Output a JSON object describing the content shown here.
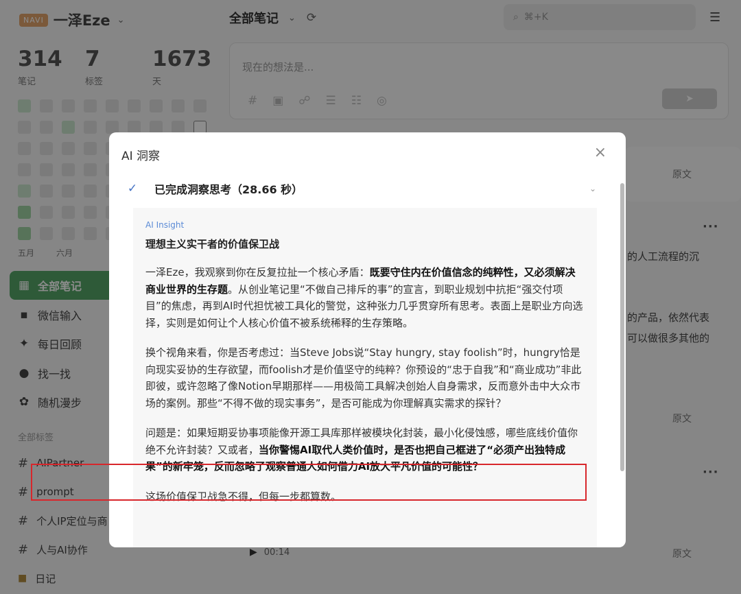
{
  "brand": {
    "badge": "NAVI",
    "name": "一泽Eze"
  },
  "stats": [
    {
      "value": "314",
      "label": "笔记"
    },
    {
      "value": "7",
      "label": "标签"
    },
    {
      "value": "1673",
      "label": "天"
    }
  ],
  "heatmap": {
    "levels": [
      1,
      0,
      0,
      0,
      0,
      0,
      0,
      0,
      0,
      0,
      0,
      1,
      0,
      0,
      0,
      0,
      0,
      -1,
      0,
      0,
      0,
      0,
      0,
      0,
      0,
      0,
      0,
      0,
      0,
      0,
      0,
      0,
      0,
      0,
      0,
      0,
      1,
      0,
      0,
      0,
      0,
      0,
      0,
      0,
      0,
      2,
      0,
      0,
      0,
      0,
      0,
      0,
      0,
      0,
      2,
      0,
      0,
      0,
      0,
      0,
      0,
      0,
      0
    ],
    "months": [
      "五月",
      "六月"
    ]
  },
  "nav": [
    {
      "label": "全部笔记",
      "icon": "grid-icon"
    },
    {
      "label": "微信输入",
      "icon": "chat-icon"
    },
    {
      "label": "每日回顾",
      "icon": "sparkle-icon"
    },
    {
      "label": "找一找",
      "icon": "glasses-icon"
    },
    {
      "label": "随机漫步",
      "icon": "flower-icon"
    }
  ],
  "tags_title": "全部标签",
  "tags": [
    "AIPartner",
    "prompt",
    "个人IP定位与商",
    "人与AI协作"
  ],
  "diary": "日记",
  "main": {
    "title": "全部笔记",
    "search_placeholder": "⌘+K",
    "composer_placeholder": "现在的想法是...",
    "orig_link": "原文",
    "peek_1": "的人工流程的沉",
    "peek_2": "的产品，依然代表",
    "peek_3": "可以做很多其他的",
    "audio_time": "00:14"
  },
  "modal": {
    "title": "AI 洞察",
    "status": "已完成洞察思考（28.66 秒）",
    "tag": "AI Insight",
    "heading": "理想主义实干者的价值保卫战",
    "p1_a": "一泽Eze，我观察到你在反复拉扯一个核心矛盾：",
    "p1_b": "既要守住内在价值信念的纯粹性，又必须解决商业世界的生存题",
    "p1_c": "。从创业笔记里“不做自己排斥的事”的宣言，到职业规划中抗拒“强交付项目”的焦虑，再到AI时代担忧被工具化的警觉，这种张力几乎贯穿所有思考。表面上是职业方向选择，实则是如何让个人核心价值不被系统稀释的生存策略。",
    "p2": "换个视角来看，你是否考虑过：当Steve Jobs说“Stay hungry, stay foolish”时，hungry恰是向现实妥协的生存欲望，而foolish才是价值坚守的纯粹？你预设的“忠于自我”和“商业成功”非此即彼，或许忽略了像Notion早期那样——用极简工具解决创始人自身需求，反而意外击中大众市场的案例。那些“不得不做的现实事务”，是否可能成为你理解真实需求的探针？",
    "p3_a": "问题是：如果短期妥协事项能像开源工具库那样被模块化封装，最小化侵蚀感，哪些底线价值你绝不允许封装？又或者，",
    "p3_b": "当你警惕AI取代人类价值时，是否也把自己框进了“必须产出独特成果”的新牢笼，反而忽略了观察普通人如何借力AI放大平凡价值的可能性？",
    "p4": "这场价值保卫战急不得，但每一步都算数。"
  },
  "colors": {
    "accent_green": "#55a466",
    "highlight_red": "#d8262b",
    "check_blue": "#4472c4"
  }
}
